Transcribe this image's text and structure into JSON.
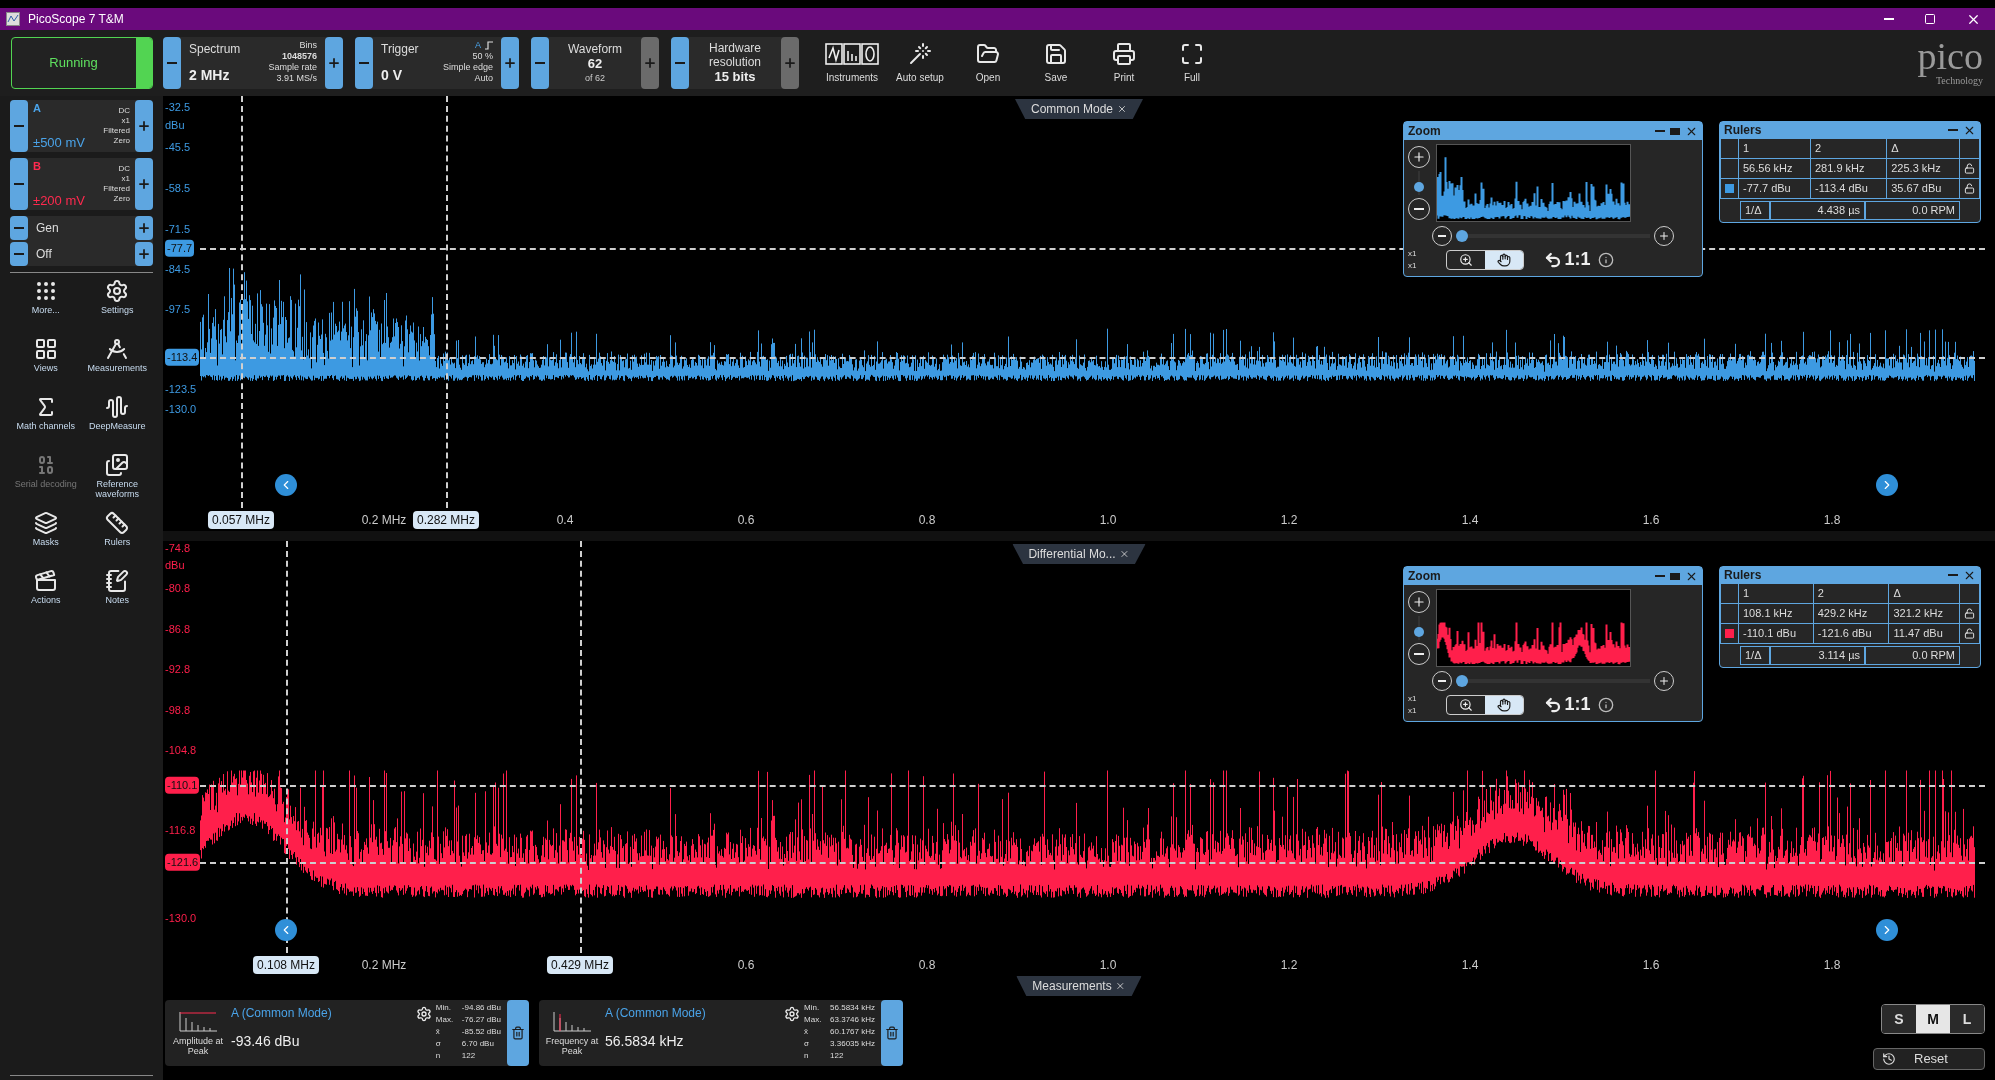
{
  "window": {
    "title": "PicoScope 7 T&M"
  },
  "run": {
    "label": "Running",
    "on": true
  },
  "controls": [
    {
      "title": "Spectrum",
      "value": "2 MHz",
      "details": [
        "Bins",
        "1048576",
        "Sample rate",
        "3.91 MS/s"
      ],
      "plus_disabled": false
    },
    {
      "title": "Trigger",
      "value": "0 V",
      "details": [
        "A",
        "50 %",
        "Simple edge",
        "Auto"
      ],
      "plus_disabled": false
    },
    {
      "title": "Waveform",
      "value": "62",
      "details": [
        "of 62"
      ],
      "plus_disabled": true
    },
    {
      "title": "Hardware resolution",
      "value": "15 bits",
      "plus_disabled": true
    }
  ],
  "toolbar_buttons": [
    "Instruments",
    "Auto setup",
    "Open",
    "Save",
    "Print",
    "Full"
  ],
  "logo": {
    "name": "pico",
    "tagline": "Technology"
  },
  "channels": [
    {
      "name": "A",
      "range": "±500 mV",
      "color": "#4aa3e8",
      "details": [
        "DC",
        "x1",
        "Filtered",
        "Zero"
      ]
    },
    {
      "name": "B",
      "range": "±200 mV",
      "color": "#ff2a4f",
      "details": [
        "DC",
        "x1",
        "Filtered",
        "Zero"
      ]
    }
  ],
  "generator": [
    "Gen",
    "Off"
  ],
  "tools": [
    {
      "label": "More...",
      "disabled": false
    },
    {
      "label": "Settings",
      "disabled": false
    },
    {
      "label": "Views",
      "disabled": false
    },
    {
      "label": "Measurements",
      "disabled": false
    },
    {
      "label": "Math channels",
      "disabled": false
    },
    {
      "label": "DeepMeasure",
      "disabled": false
    },
    {
      "label": "Serial decoding",
      "disabled": true
    },
    {
      "label": "Reference waveforms",
      "disabled": false
    },
    {
      "label": "Masks",
      "disabled": false
    },
    {
      "label": "Rulers",
      "disabled": false
    },
    {
      "label": "Actions",
      "disabled": false
    },
    {
      "label": "Notes",
      "disabled": false
    }
  ],
  "plots": [
    {
      "tab": "Common Mode",
      "color": "#3d9ae2",
      "y_ticks": [
        {
          "label": "-32.5",
          "kind": "tick"
        },
        {
          "label": "dBu",
          "kind": "unit"
        },
        {
          "label": "-45.5",
          "kind": "tick"
        },
        {
          "label": "-58.5",
          "kind": "tick"
        },
        {
          "label": "-71.5",
          "kind": "tick"
        },
        {
          "label": "-77.7",
          "kind": "ruler"
        },
        {
          "label": "-84.5",
          "kind": "tick"
        },
        {
          "label": "-97.5",
          "kind": "tick"
        },
        {
          "label": "-113.4",
          "kind": "ruler"
        },
        {
          "label": "-123.5",
          "kind": "tick"
        },
        {
          "label": "-130.0",
          "kind": "tick"
        }
      ],
      "x_ticks": [
        "0.2 MHz",
        "0.4",
        "0.6",
        "0.8",
        "1.0",
        "1.2",
        "1.4",
        "1.6",
        "1.8"
      ],
      "x_rulers": [
        "0.057 MHz",
        "0.282 MHz"
      ],
      "zoom": {
        "title": "Zoom",
        "vertical_slider": {
          "level": 0.35
        },
        "horizontal_slider": {
          "level": 0
        },
        "scales": [
          "x1",
          "x1"
        ],
        "ratio": "1:1"
      },
      "rulers": {
        "title": "Rulers",
        "columns": [
          "1",
          "2",
          "Δ"
        ],
        "x_row": [
          "56.56 kHz",
          "281.9 kHz",
          "225.3 kHz"
        ],
        "y_row": [
          "-77.7 dBu",
          "-113.4 dBu",
          "35.67 dBu"
        ],
        "inverse": [
          "1/Δ",
          "4.438 µs",
          "0.0 RPM"
        ]
      }
    },
    {
      "tab": "Differential Mo...",
      "color": "#ff1f4b",
      "y_ticks": [
        {
          "label": "-74.8",
          "kind": "tick"
        },
        {
          "label": "dBu",
          "kind": "unit"
        },
        {
          "label": "-80.8",
          "kind": "tick"
        },
        {
          "label": "-86.8",
          "kind": "tick"
        },
        {
          "label": "-92.8",
          "kind": "tick"
        },
        {
          "label": "-98.8",
          "kind": "tick"
        },
        {
          "label": "-104.8",
          "kind": "tick"
        },
        {
          "label": "-110.1",
          "kind": "ruler"
        },
        {
          "label": "-116.8",
          "kind": "tick"
        },
        {
          "label": "-121.6",
          "kind": "ruler"
        },
        {
          "label": "-130.0",
          "kind": "tick"
        }
      ],
      "x_ticks": [
        "0.2 MHz",
        "0.6",
        "0.8",
        "1.0",
        "1.2",
        "1.4",
        "1.6",
        "1.8"
      ],
      "x_rulers": [
        "0.108 MHz",
        "0.429 MHz"
      ],
      "zoom": {
        "title": "Zoom",
        "vertical_slider": {
          "level": 0.35
        },
        "horizontal_slider": {
          "level": 0
        },
        "scales": [
          "x1",
          "x1"
        ],
        "ratio": "1:1"
      },
      "rulers": {
        "title": "Rulers",
        "columns": [
          "1",
          "2",
          "Δ"
        ],
        "x_row": [
          "108.1 kHz",
          "429.2 kHz",
          "321.2 kHz"
        ],
        "y_row": [
          "-110.1 dBu",
          "-121.6 dBu",
          "11.47 dBu"
        ],
        "inverse": [
          "1/Δ",
          "3.114 µs",
          "0.0 RPM"
        ]
      }
    }
  ],
  "measurements_tab": "Measurements",
  "measurements": [
    {
      "channel": "A (Common Mode)",
      "name": "Amplitude at Peak",
      "value": "-93.46 dBu",
      "stats": [
        [
          "Min.",
          "-94.86 dBu"
        ],
        [
          "Max.",
          "-76.27 dBu"
        ],
        [
          "x̄",
          "-85.52 dBu"
        ],
        [
          "σ",
          "6.70 dBu"
        ],
        [
          "n",
          "122"
        ]
      ]
    },
    {
      "channel": "A (Common Mode)",
      "name": "Frequency at Peak",
      "value": "56.5834 kHz",
      "stats": [
        [
          "Min.",
          "56.5834 kHz"
        ],
        [
          "Max.",
          "63.3746 kHz"
        ],
        [
          "x̄",
          "60.1767 kHz"
        ],
        [
          "σ",
          "3.36035 kHz"
        ],
        [
          "n",
          "122"
        ]
      ]
    }
  ],
  "sizes": [
    {
      "label": "S",
      "selected": false
    },
    {
      "label": "M",
      "selected": true
    },
    {
      "label": "L",
      "selected": false
    }
  ],
  "reset": "Reset"
}
